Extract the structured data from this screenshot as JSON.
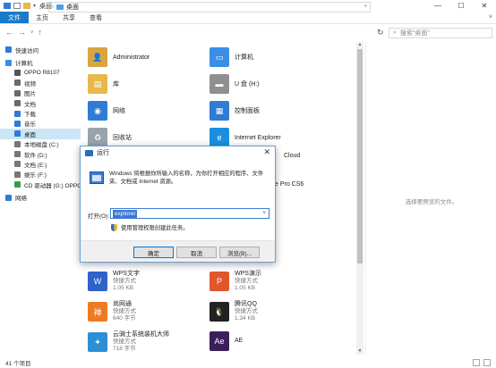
{
  "window": {
    "title": "桌面",
    "controls": {
      "minimize": "—",
      "maximize": "☐",
      "close": "✕"
    }
  },
  "ribbon": {
    "tabs": [
      "文件",
      "主页",
      "共享",
      "查看"
    ],
    "expand": "˅"
  },
  "address": {
    "back": "←",
    "forward": "→",
    "up_history": "˅",
    "up": "↑",
    "crumb": "桌面",
    "refresh": "↻",
    "search_placeholder": "搜索\"桌面\""
  },
  "nav": {
    "items": [
      {
        "label": "快速访问",
        "icon": "star-icon",
        "color": "#2f7bd6"
      },
      {
        "label": "计算机",
        "icon": "computer-icon",
        "color": "#3a8ee6"
      },
      {
        "label": "OPPO R8107",
        "icon": "phone-icon",
        "color": "#555555",
        "level": 2
      },
      {
        "label": "视频",
        "icon": "video-icon",
        "color": "#6a6a6a",
        "level": 2
      },
      {
        "label": "图片",
        "icon": "picture-icon",
        "color": "#6a6a6a",
        "level": 2
      },
      {
        "label": "文档",
        "icon": "document-icon",
        "color": "#6a6a6a",
        "level": 2
      },
      {
        "label": "下载",
        "icon": "download-icon",
        "color": "#2f7bd6",
        "level": 2
      },
      {
        "label": "音乐",
        "icon": "music-icon",
        "color": "#2f7bd6",
        "level": 2
      },
      {
        "label": "桌面",
        "icon": "desktop-icon",
        "color": "#2f7bd6",
        "level": 2,
        "selected": true
      },
      {
        "label": "本地磁盘 (C:)",
        "icon": "drive-icon",
        "color": "#777777",
        "level": 2
      },
      {
        "label": "软件 (D:)",
        "icon": "drive-icon",
        "color": "#777777",
        "level": 2
      },
      {
        "label": "文档 (E:)",
        "icon": "drive-icon",
        "color": "#777777",
        "level": 2
      },
      {
        "label": "娱乐 (F:)",
        "icon": "drive-icon",
        "color": "#777777",
        "level": 2
      },
      {
        "label": "CD 驱动器 (G:) OPPO",
        "icon": "cd-icon",
        "color": "#3a9a4a",
        "level": 2
      },
      {
        "label": "网络",
        "icon": "network-icon",
        "color": "#2f7bd6"
      }
    ]
  },
  "content": {
    "col1": [
      {
        "name": "Administrator",
        "icon": "user-folder-icon",
        "color": "#d9a441",
        "glyph": "👤"
      },
      {
        "name": "库",
        "icon": "library-icon",
        "color": "#e8b84a",
        "glyph": "▤"
      },
      {
        "name": "网络",
        "icon": "network-icon",
        "color": "#2f7bd6",
        "glyph": "◉"
      },
      {
        "name": "回收站",
        "icon": "recycle-bin-icon",
        "color": "#9aa3ad",
        "glyph": "♻"
      }
    ],
    "col2": [
      {
        "name": "计算机",
        "icon": "computer-icon",
        "color": "#3a8ee6",
        "glyph": "▭"
      },
      {
        "name": "U 盘 (H:)",
        "icon": "usb-drive-icon",
        "color": "#8f8f8f",
        "glyph": "▬"
      },
      {
        "name": "控制面板",
        "icon": "control-panel-icon",
        "color": "#2f7bd6",
        "glyph": "▦"
      },
      {
        "name": "Internet Explorer",
        "icon": "ie-icon",
        "color": "#1a8fe0",
        "glyph": "e"
      }
    ],
    "partial": [
      {
        "name": "Cloud"
      },
      {
        "name": "e Pro CS6"
      }
    ],
    "files_left": [
      {
        "name": "WPS文字",
        "type": "快捷方式",
        "size": "1.05 KB",
        "icon": "wps-writer-icon",
        "color": "#2f63c9",
        "glyph": "W"
      },
      {
        "name": "尚网通",
        "type": "快捷方式",
        "size": "640 字节",
        "icon": "app-icon",
        "color": "#f07a22",
        "glyph": "禅"
      },
      {
        "name": "云骑士系统装机大师",
        "type": "快捷方式",
        "size": "718 字节",
        "icon": "app-icon",
        "color": "#2c8fd6",
        "glyph": "✦"
      }
    ],
    "files_right": [
      {
        "name": "WPS演示",
        "type": "快捷方式",
        "size": "1.05 KB",
        "icon": "wps-presentation-icon",
        "color": "#e0572b",
        "glyph": "P"
      },
      {
        "name": "腾讯QQ",
        "type": "快捷方式",
        "size": "1.34 KB",
        "icon": "qq-icon",
        "color": "#222222",
        "glyph": "🐧"
      },
      {
        "name": "AE",
        "type": "",
        "size": "",
        "icon": "ae-icon",
        "color": "#3a1f5c",
        "glyph": "Ae"
      }
    ]
  },
  "preview": {
    "message": "选择要预览的文件。"
  },
  "status": {
    "count": "41 个项目"
  },
  "run_dialog": {
    "title": "运行",
    "close": "✕",
    "description": "Windows 将根据你所输入的名称，为你打开相应的程序、文件夹、文档或 Internet 资源。",
    "open_label": "打开(O):",
    "open_value": "explorer",
    "admin_note": "使用管理权限创建此任务。",
    "ok": "确定",
    "cancel": "取消",
    "browse": "浏览(B)..."
  }
}
